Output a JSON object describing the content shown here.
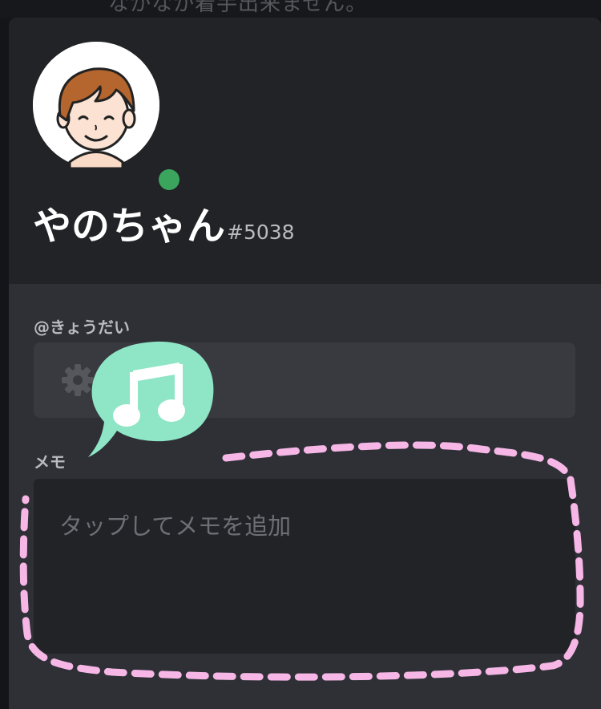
{
  "topbar": {
    "text": "なかなか着手出来ません。"
  },
  "profile": {
    "username": "やのちゃん",
    "discriminator": "#5038",
    "status_color": "#3ba55d"
  },
  "role_section": {
    "label": "@きょうだい",
    "icon": "gear-icon"
  },
  "memo_section": {
    "label": "メモ",
    "placeholder": "タップしてメモを追加"
  },
  "decorations": {
    "sticker_icon": "music-note-icon",
    "sticker_color": "#8ee6c6",
    "highlight_color": "#f6b6e6"
  }
}
